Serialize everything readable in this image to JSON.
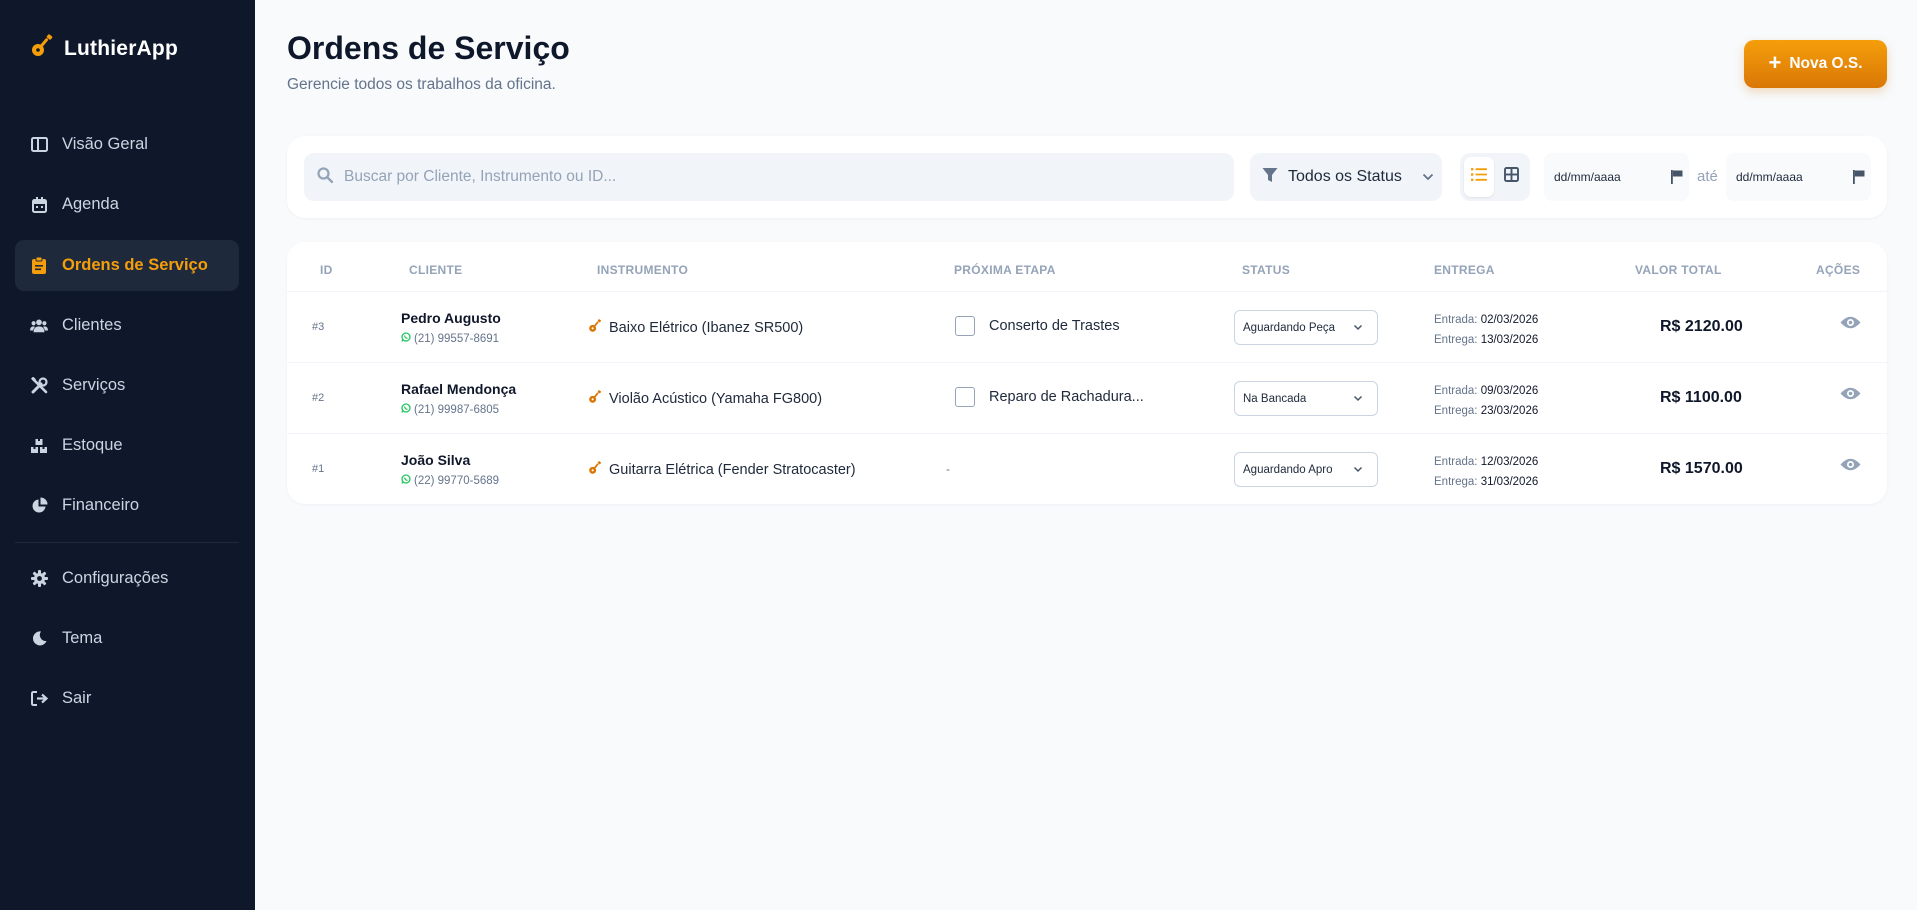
{
  "app": {
    "name": "LuthierApp"
  },
  "sidebar": {
    "items": [
      {
        "label": "Visão Geral",
        "icon": "layout-icon"
      },
      {
        "label": "Agenda",
        "icon": "calendar-icon"
      },
      {
        "label": "Ordens de Serviço",
        "icon": "clipboard-icon",
        "active": true
      },
      {
        "label": "Clientes",
        "icon": "users-icon"
      },
      {
        "label": "Serviços",
        "icon": "tools-icon"
      },
      {
        "label": "Estoque",
        "icon": "boxes-icon"
      },
      {
        "label": "Financeiro",
        "icon": "pie-chart-icon"
      }
    ],
    "bottom_items": [
      {
        "label": "Configurações",
        "icon": "gear-icon"
      },
      {
        "label": "Tema",
        "icon": "moon-icon"
      },
      {
        "label": "Sair",
        "icon": "logout-icon"
      }
    ]
  },
  "header": {
    "title": "Ordens de Serviço",
    "subtitle": "Gerencie todos os trabalhos da oficina.",
    "new_button": "Nova O.S."
  },
  "filters": {
    "search_placeholder": "Buscar por Cliente, Instrumento ou ID...",
    "status_value": "Todos os Status",
    "date_from_placeholder": "dd/mm/aaaa",
    "date_to_placeholder": "dd/mm/aaaa",
    "date_separator": "até"
  },
  "table": {
    "columns": [
      "ID",
      "CLIENTE",
      "INSTRUMENTO",
      "PRÓXIMA ETAPA",
      "STATUS",
      "ENTREGA",
      "VALOR TOTAL",
      "AÇÕES"
    ],
    "rows": [
      {
        "id": "#3",
        "client": "Pedro Augusto",
        "phone": "(21) 99557-8691",
        "instrument": "Baixo Elétrico (Ibanez SR500)",
        "next_step": "Conserto de Trastes",
        "status": "Aguardando Peça",
        "entrada_label": "Entrada:",
        "entrada": "02/03/2026",
        "entrega_label": "Entrega:",
        "entrega": "13/03/2026",
        "total": "R$ 2120.00"
      },
      {
        "id": "#2",
        "client": "Rafael Mendonça",
        "phone": "(21) 99987-6805",
        "instrument": "Violão Acústico (Yamaha FG800)",
        "next_step": "Reparo de Rachadura...",
        "status": "Na Bancada",
        "entrada_label": "Entrada:",
        "entrada": "09/03/2026",
        "entrega_label": "Entrega:",
        "entrega": "23/03/2026",
        "total": "R$ 1100.00"
      },
      {
        "id": "#1",
        "client": "João Silva",
        "phone": "(22) 99770-5689",
        "instrument": "Guitarra Elétrica (Fender Stratocaster)",
        "next_step": "-",
        "status": "Aguardando Apro",
        "entrada_label": "Entrada:",
        "entrada": "12/03/2026",
        "entrega_label": "Entrega:",
        "entrega": "31/03/2026",
        "total": "R$ 1570.00"
      }
    ]
  },
  "colors": {
    "sidebar_bg": "#0f172a",
    "accent": "#f59e0b",
    "page_bg": "#f8fafc",
    "whatsapp": "#22c55e"
  }
}
